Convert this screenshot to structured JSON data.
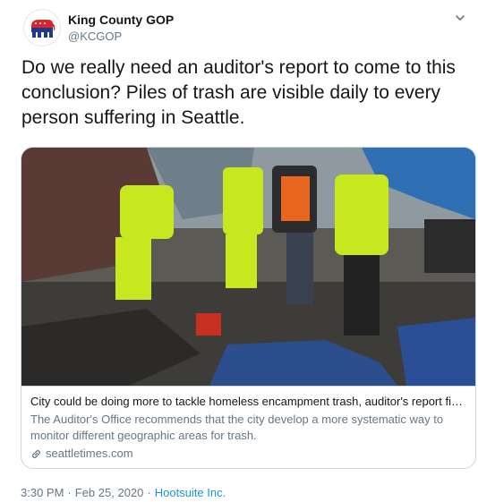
{
  "author": {
    "display_name": "King County GOP",
    "handle": "@KCGOP",
    "avatar_icon": "republican-elephant-icon"
  },
  "tweet": {
    "text": "Do we really need an auditor's report to come to this conclusion? Piles of trash are visible daily to every person suffering in Seattle."
  },
  "card": {
    "title": "City could be doing more to tackle homeless encampment trash, auditor's report finds",
    "description": "The Auditor's Office recommends that the city develop a more systematic way to monitor different geographic areas for trash.",
    "domain": "seattletimes.com",
    "link_icon": "link-icon"
  },
  "meta": {
    "time": "3:30 PM",
    "separator": "·",
    "date": "Feb 25, 2020",
    "source": "Hootsuite Inc."
  },
  "colors": {
    "brand_red": "#d9252a",
    "brand_blue": "#1b3c8e",
    "link_blue": "#1b95e0",
    "muted": "#657786"
  }
}
